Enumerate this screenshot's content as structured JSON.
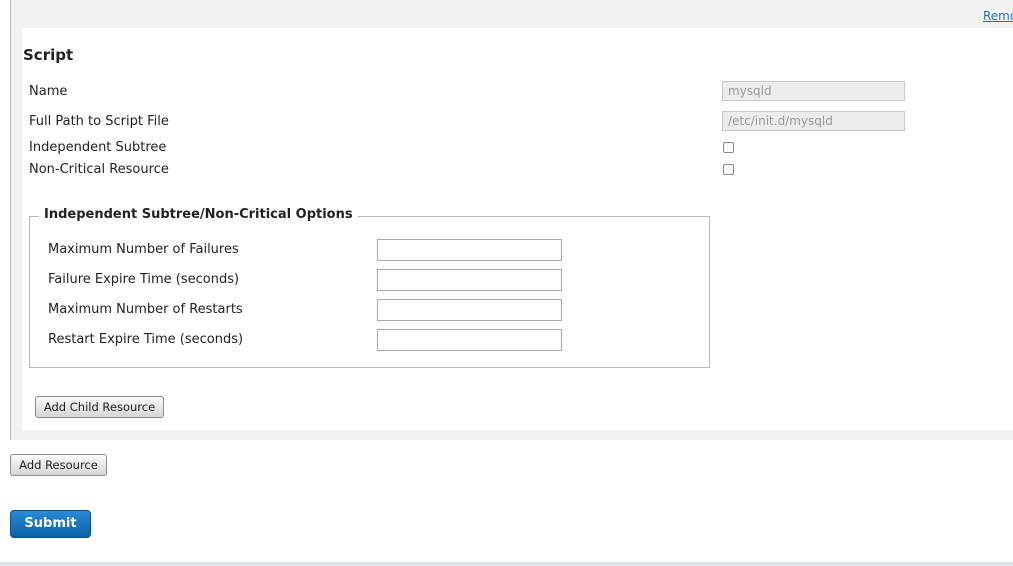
{
  "remove_link": "Remo",
  "section": {
    "title": "Script"
  },
  "fields": {
    "name": {
      "label": "Name",
      "value": "mysqld"
    },
    "path": {
      "label": "Full Path to Script File",
      "value": "/etc/init.d/mysqld"
    },
    "independent_subtree": {
      "label": "Independent Subtree",
      "checked": false
    },
    "non_critical": {
      "label": "Non-Critical Resource",
      "checked": false
    }
  },
  "options": {
    "legend": "Independent Subtree/Non-Critical Options",
    "max_failures": {
      "label": "Maximum Number of Failures",
      "value": ""
    },
    "failure_expire": {
      "label": "Failure Expire Time (seconds)",
      "value": ""
    },
    "max_restarts": {
      "label": "Maximum Number of Restarts",
      "value": ""
    },
    "restart_expire": {
      "label": "Restart Expire Time (seconds)",
      "value": ""
    }
  },
  "buttons": {
    "add_child": "Add Child Resource",
    "add_resource": "Add Resource",
    "submit": "Submit"
  }
}
